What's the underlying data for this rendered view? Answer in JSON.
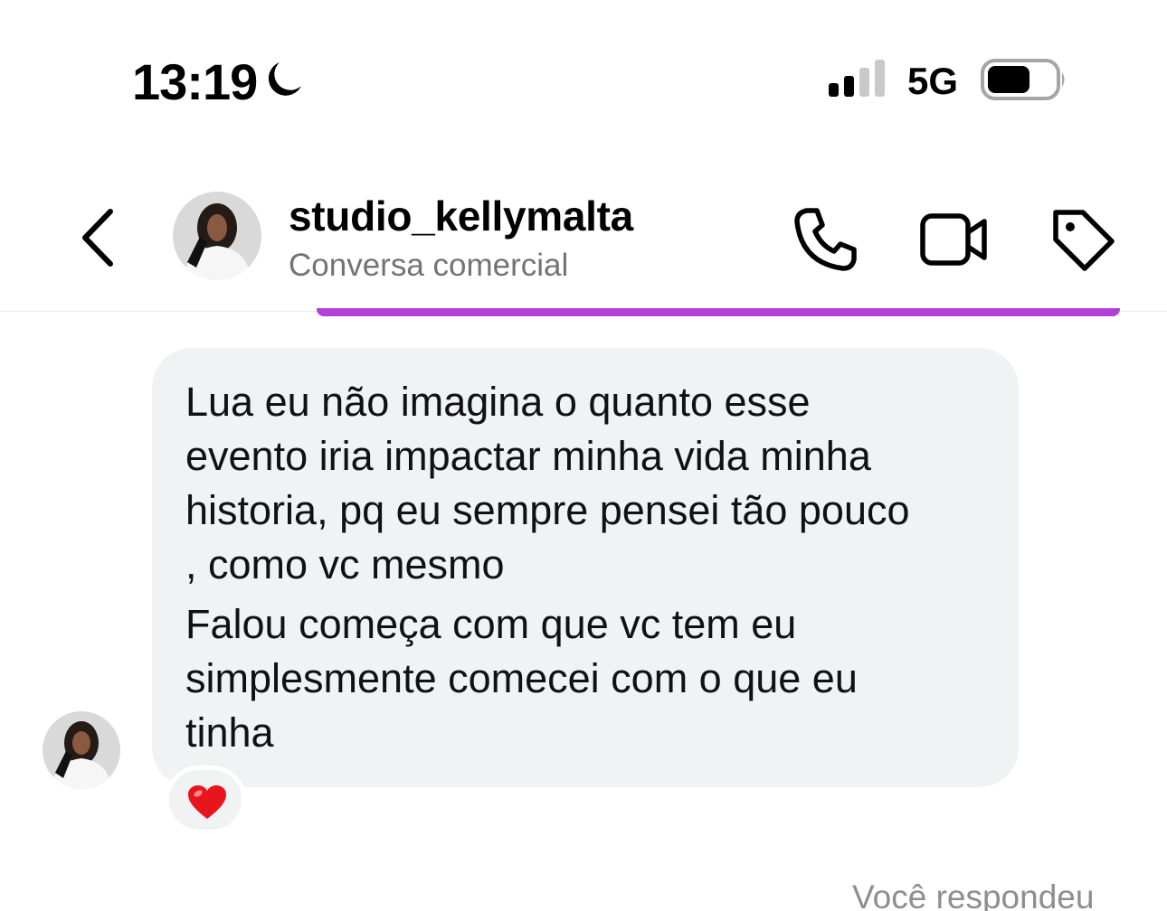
{
  "status_bar": {
    "time": "13:19",
    "network": "5G",
    "icons": [
      "moon-icon",
      "signal-icon",
      "battery-icon"
    ]
  },
  "header": {
    "username": "studio_kellymalta",
    "subtitle": "Conversa comercial",
    "icons": [
      "chevron-left-icon",
      "phone-icon",
      "video-camera-icon",
      "tag-icon"
    ]
  },
  "message": {
    "paragraphs": [
      "Lua eu não imagina o quanto esse\nevento iria impactar minha vida minha\nhistoria, pq eu sempre pensei tão pouco\n, como vc mesmo",
      "Falou começa com que vc tem eu\nsimplesmente comecei com o que eu\ntinha"
    ],
    "reaction": "heart-emoji"
  },
  "footer": {
    "replied_label": "Você respondeu"
  },
  "colors": {
    "accent_line": "#b23fd6",
    "bubble": "#f1f2f4",
    "subtitle": "#737373"
  }
}
